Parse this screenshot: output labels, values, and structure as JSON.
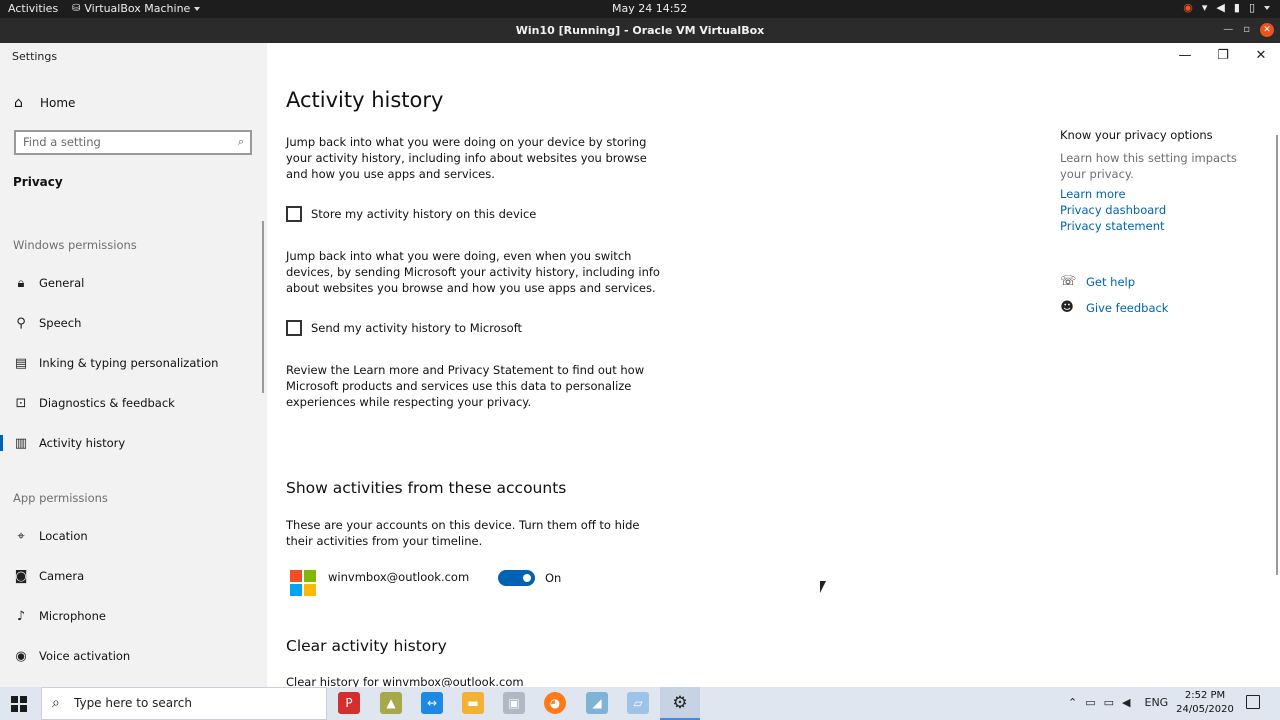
{
  "topbar": {
    "activities": "Activities",
    "vm_menu": "VirtualBox Machine",
    "clock": "May 24  14:52"
  },
  "vbox": {
    "title": "Win10 [Running] - Oracle VM VirtualBox"
  },
  "settings": {
    "app_title": "Settings",
    "sidebar": {
      "home": "Home",
      "search_placeholder": "Find a setting",
      "category": "Privacy",
      "windows_permissions_label": "Windows permissions",
      "windows_permissions": [
        {
          "label": "General",
          "icon": "lock-icon"
        },
        {
          "label": "Speech",
          "icon": "speech-icon"
        },
        {
          "label": "Inking & typing personalization",
          "icon": "inking-icon"
        },
        {
          "label": "Diagnostics & feedback",
          "icon": "diagnostics-icon"
        },
        {
          "label": "Activity history",
          "icon": "activity-icon",
          "selected": true
        }
      ],
      "app_permissions_label": "App permissions",
      "app_permissions": [
        {
          "label": "Location",
          "icon": "location-icon"
        },
        {
          "label": "Camera",
          "icon": "camera-icon"
        },
        {
          "label": "Microphone",
          "icon": "microphone-icon"
        },
        {
          "label": "Voice activation",
          "icon": "voice-activation-icon"
        }
      ]
    },
    "main": {
      "title": "Activity history",
      "intro": "Jump back into what you were doing on your device by storing your activity history, including info about websites you browse and how you use apps and services.",
      "store_checkbox": "Store my activity history on this device",
      "switch_para": "Jump back into what you were doing, even when you switch devices, by sending Microsoft your activity history, including info about websites you browse and how you use apps and services.",
      "send_checkbox": "Send my activity history to Microsoft",
      "review_para": "Review the Learn more and Privacy Statement to find out how Microsoft products and services use this data to personalize experiences while respecting your privacy.",
      "accounts_heading": "Show activities from these accounts",
      "accounts_para": "These are your accounts on this device. Turn them off to hide their activities from your timeline.",
      "account_email": "winvmbox@outlook.com",
      "account_toggle_state": "On",
      "clear_heading": "Clear activity history",
      "clear_for": "Clear history for winvmbox@outlook.com"
    },
    "rail": {
      "heading": "Know your privacy options",
      "desc": "Learn how this setting impacts your privacy.",
      "links": [
        "Learn more",
        "Privacy dashboard",
        "Privacy statement"
      ],
      "get_help": "Get help",
      "give_feedback": "Give feedback"
    }
  },
  "taskbar": {
    "search_placeholder": "Type here to search",
    "lang": "ENG",
    "time": "2:52 PM",
    "date": "24/05/2020"
  },
  "colors": {
    "accent": "#0063b1",
    "ubuntu_close": "#e95420"
  }
}
